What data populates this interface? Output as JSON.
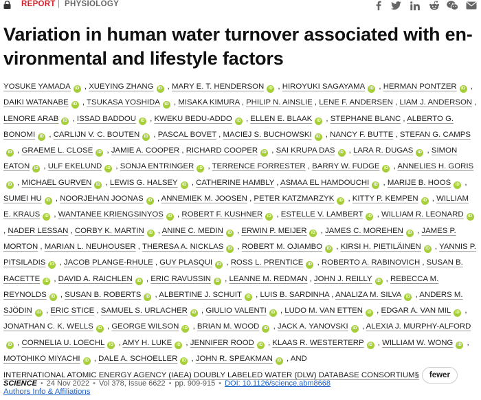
{
  "header": {
    "section": "REPORT",
    "separator": "|",
    "category": "PHYSIOLOGY",
    "share_icons": [
      "facebook-icon",
      "twitter-icon",
      "linkedin-icon",
      "reddit-icon",
      "wechat-icon",
      "email-icon"
    ]
  },
  "article": {
    "title": "Variation in human water turnover associated with en­vironmental and lifestyle factors"
  },
  "authors": [
    {
      "name": "YOSUKE YAMADA",
      "orcid": true
    },
    {
      "name": "XUEYING ZHANG",
      "orcid": true
    },
    {
      "name": "MARY E. T. HENDERSON",
      "orcid": true
    },
    {
      "name": "HIROYUKI SAGAYAMA",
      "orcid": true
    },
    {
      "name": "HERMAN PONTZER",
      "orcid": true
    },
    {
      "name": "DAIKI WATANABE",
      "orcid": true
    },
    {
      "name": "TSUKASA YOSHIDA",
      "orcid": true
    },
    {
      "name": "MISAKA KIMURA",
      "orcid": false
    },
    {
      "name": "PHILIP N. AINSLIE",
      "orcid": false
    },
    {
      "name": "LENE F. ANDERSEN",
      "orcid": false
    },
    {
      "name": "LIAM J. ANDERSON",
      "orcid": false
    },
    {
      "name": "LENORE ARAB",
      "orcid": true
    },
    {
      "name": "ISSAD BADDOU",
      "orcid": true
    },
    {
      "name": "KWEKU BEDU-ADDO",
      "orcid": true
    },
    {
      "name": "ELLEN E. BLAAK",
      "orcid": true
    },
    {
      "name": "STEPHANE BLANC",
      "orcid": false
    },
    {
      "name": "ALBERTO G. BONOMI",
      "orcid": true
    },
    {
      "name": "CARLIJN V. C. BOUTEN",
      "orcid": true
    },
    {
      "name": "PASCAL BOVET",
      "orcid": false
    },
    {
      "name": "MACIEJ S. BUCHOWSKI",
      "orcid": true
    },
    {
      "name": "NANCY F. BUTTE",
      "orcid": false
    },
    {
      "name": "STEFAN G. CAMPS",
      "orcid": true
    },
    {
      "name": "GRAEME L. CLOSE",
      "orcid": true
    },
    {
      "name": "JAMIE A. COOPER",
      "orcid": false
    },
    {
      "name": "RICHARD COOPER",
      "orcid": true
    },
    {
      "name": "SAI KRUPA DAS",
      "orcid": true
    },
    {
      "name": "LARA R. DUGAS",
      "orcid": true
    },
    {
      "name": "SIMON EATON",
      "orcid": true
    },
    {
      "name": "ULF EKELUND",
      "orcid": true
    },
    {
      "name": "SONJA ENTRINGER",
      "orcid": true
    },
    {
      "name": "TERRENCE FORRESTER",
      "orcid": false
    },
    {
      "name": "BARRY W. FUDGE",
      "orcid": true
    },
    {
      "name": "ANNELIES H. GORIS",
      "orcid": true
    },
    {
      "name": "MICHAEL GURVEN",
      "orcid": true
    },
    {
      "name": "LEWIS G. HALSEY",
      "orcid": true
    },
    {
      "name": "CATHERINE HAMBLY",
      "orcid": false
    },
    {
      "name": "ASMAA EL HAMDOUCHI",
      "orcid": true
    },
    {
      "name": "MARIJE B. HOOS",
      "orcid": true
    },
    {
      "name": "SUMEI HU",
      "orcid": true
    },
    {
      "name": "NOORJEHAN JOONAS",
      "orcid": true
    },
    {
      "name": "ANNEMIEK M. JOOSEN",
      "orcid": false
    },
    {
      "name": "PETER KATZMARZYK",
      "orcid": true
    },
    {
      "name": "KITTY P. KEMPEN",
      "orcid": true
    },
    {
      "name": "WILLIAM E. KRAUS",
      "orcid": true
    },
    {
      "name": "WANTANEE KRIENGSINYOS",
      "orcid": true
    },
    {
      "name": "ROBERT F. KUSHNER",
      "orcid": true
    },
    {
      "name": "ESTELLE V. LAMBERT",
      "orcid": true
    },
    {
      "name": "WILLIAM R. LEONARD",
      "orcid": true
    },
    {
      "name": "NADER LESSAN",
      "orcid": false
    },
    {
      "name": "CORBY K. MARTIN",
      "orcid": true
    },
    {
      "name": "ANINE C. MEDIN",
      "orcid": true
    },
    {
      "name": "ERWIN P. MEIJER",
      "orcid": true
    },
    {
      "name": "JAMES C. MOREHEN",
      "orcid": true
    },
    {
      "name": "JAMES P. MORTON",
      "orcid": false
    },
    {
      "name": "MARIAN L. NEUHOUSER",
      "orcid": false
    },
    {
      "name": "THERESA A. NICKLAS",
      "orcid": true
    },
    {
      "name": "ROBERT M. OJIAMBO",
      "orcid": true
    },
    {
      "name": "KIRSI H. PIETILÄINEN",
      "orcid": true
    },
    {
      "name": "YANNIS P. PITSILADIS",
      "orcid": true
    },
    {
      "name": "JACOB PLANGE-RHULE",
      "orcid": false
    },
    {
      "name": "GUY PLASQUI",
      "orcid": true
    },
    {
      "name": "ROSS L. PRENTICE",
      "orcid": true
    },
    {
      "name": "ROBERTO A. RABINOVICH",
      "orcid": false
    },
    {
      "name": "SUSAN B. RACETTE",
      "orcid": true
    },
    {
      "name": "DAVID A. RAICHLEN",
      "orcid": true
    },
    {
      "name": "ERIC RAVUSSIN",
      "orcid": true
    },
    {
      "name": "LEANNE M. REDMAN",
      "orcid": false
    },
    {
      "name": "JOHN J. REILLY",
      "orcid": true
    },
    {
      "name": "REBECCA M. REYNOLDS",
      "orcid": true
    },
    {
      "name": "SUSAN B. ROBERTS",
      "orcid": true
    },
    {
      "name": "ALBERTINE J. SCHUIT",
      "orcid": true
    },
    {
      "name": "LUIS B. SARDINHA",
      "orcid": false
    },
    {
      "name": "ANALIZA M. SILVA",
      "orcid": true
    },
    {
      "name": "ANDERS M. SJÖDIN",
      "orcid": true
    },
    {
      "name": "ERIC STICE",
      "orcid": false
    },
    {
      "name": "SAMUEL S. URLACHER",
      "orcid": true
    },
    {
      "name": "GIULIO VALENTI",
      "orcid": true
    },
    {
      "name": "LUDO M. VAN ETTEN",
      "orcid": true
    },
    {
      "name": "EDGAR A. VAN MIL",
      "orcid": true
    },
    {
      "name": "JONATHAN C. K. WELLS",
      "orcid": true
    },
    {
      "name": "GEORGE WILSON",
      "orcid": true
    },
    {
      "name": "BRIAN M. WOOD",
      "orcid": true
    },
    {
      "name": "JACK A. YANOVSKI",
      "orcid": true
    },
    {
      "name": "ALEXIA J. MURPHY-ALFORD",
      "orcid": true
    },
    {
      "name": "CORNELIA U. LOECHL",
      "orcid": true
    },
    {
      "name": "AMY H. LUKE",
      "orcid": true
    },
    {
      "name": "JENNIFER ROOD",
      "orcid": true
    },
    {
      "name": "KLAAS R. WESTERTERP",
      "orcid": true
    },
    {
      "name": "WILLIAM W. WONG",
      "orcid": true
    },
    {
      "name": "MOTOHIKO MIYACHI",
      "orcid": true
    },
    {
      "name": "DALE A. SCHOELLER",
      "orcid": true
    },
    {
      "name": "JOHN R. SPEAKMAN",
      "orcid": true
    }
  ],
  "author_list": {
    "and_label": "AND",
    "consortium": "INTERNATIONAL ATOMIC ENERGY AGENCY (IAEA) DOUBLY LABELED WATER (DLW) DATABASE CONSORTIUM§",
    "fewer_label": "fewer",
    "authors_info_label": "Authors Info & Affiliations",
    "orcid_badge": "iD"
  },
  "citation": {
    "journal": "SCIENCE",
    "date": "24 Nov 2022",
    "volume": "Vol 378, Issue 6622",
    "pages": "pp. 909-915",
    "doi": "DOI: 10.1126/science.abm8668"
  }
}
